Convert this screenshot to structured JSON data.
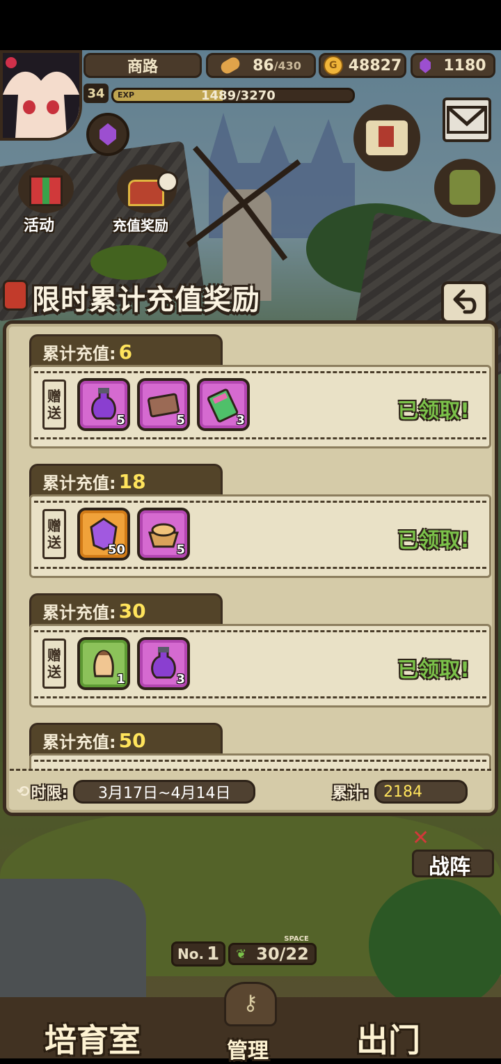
{
  "hud": {
    "location": "商路",
    "stamina_value": "86",
    "stamina_max": "/430",
    "gold": "48827",
    "gems": "1180",
    "level": "34",
    "exp_label": "EXP",
    "exp_text": "1489/3270",
    "exp_progress": 0.455
  },
  "side_buttons": {
    "activity_label": "活动",
    "recharge_reward_label": "充值奖励"
  },
  "panel": {
    "title": "限时累计充值奖励",
    "tiers": [
      {
        "label": "累计充值:",
        "amount": "6",
        "gift_tag": [
          "赠",
          "送"
        ],
        "items": [
          {
            "icon": "purple-potion-icon",
            "frame": "purple",
            "qty": "5"
          },
          {
            "icon": "ticket-icon",
            "frame": "purple",
            "qty": "5"
          },
          {
            "icon": "book-icon",
            "frame": "purple",
            "qty": "3"
          }
        ],
        "status": "已领取!"
      },
      {
        "label": "累计充值:",
        "amount": "18",
        "gift_tag": [
          "赠",
          "送"
        ],
        "items": [
          {
            "icon": "purple-gem-icon",
            "frame": "orange",
            "qty": "50"
          },
          {
            "icon": "bread-basket-icon",
            "frame": "purple",
            "qty": "5"
          }
        ],
        "status": "已领取!"
      },
      {
        "label": "累计充值:",
        "amount": "30",
        "gift_tag": [
          "赠",
          "送"
        ],
        "items": [
          {
            "icon": "pudding-icon",
            "frame": "green",
            "qty": "1"
          },
          {
            "icon": "purple-potion-icon",
            "frame": "purple",
            "qty": "3"
          }
        ],
        "status": "已领取!"
      },
      {
        "label": "累计充值:",
        "amount": "50"
      }
    ],
    "time_limit_label": "时限:",
    "time_range": "3月17日~4月14日",
    "total_label": "累计:",
    "total_value": "2184"
  },
  "bottom": {
    "formation_label": "战阵",
    "no_label": "No.",
    "no_value": "1",
    "space_label": "SPACE",
    "space_value": "30/22",
    "nursery_label": "培育室",
    "manage_label": "管理",
    "exit_label": "出门"
  },
  "colors": {
    "panel_bg": "#d5cba8",
    "tab_bg": "#534429",
    "amount_yellow": "#ffe45c",
    "claimed_green": "#7bc24a",
    "frame_purple": "#d56ad0",
    "frame_orange": "#f0a23a",
    "frame_green": "#8cc25a"
  }
}
